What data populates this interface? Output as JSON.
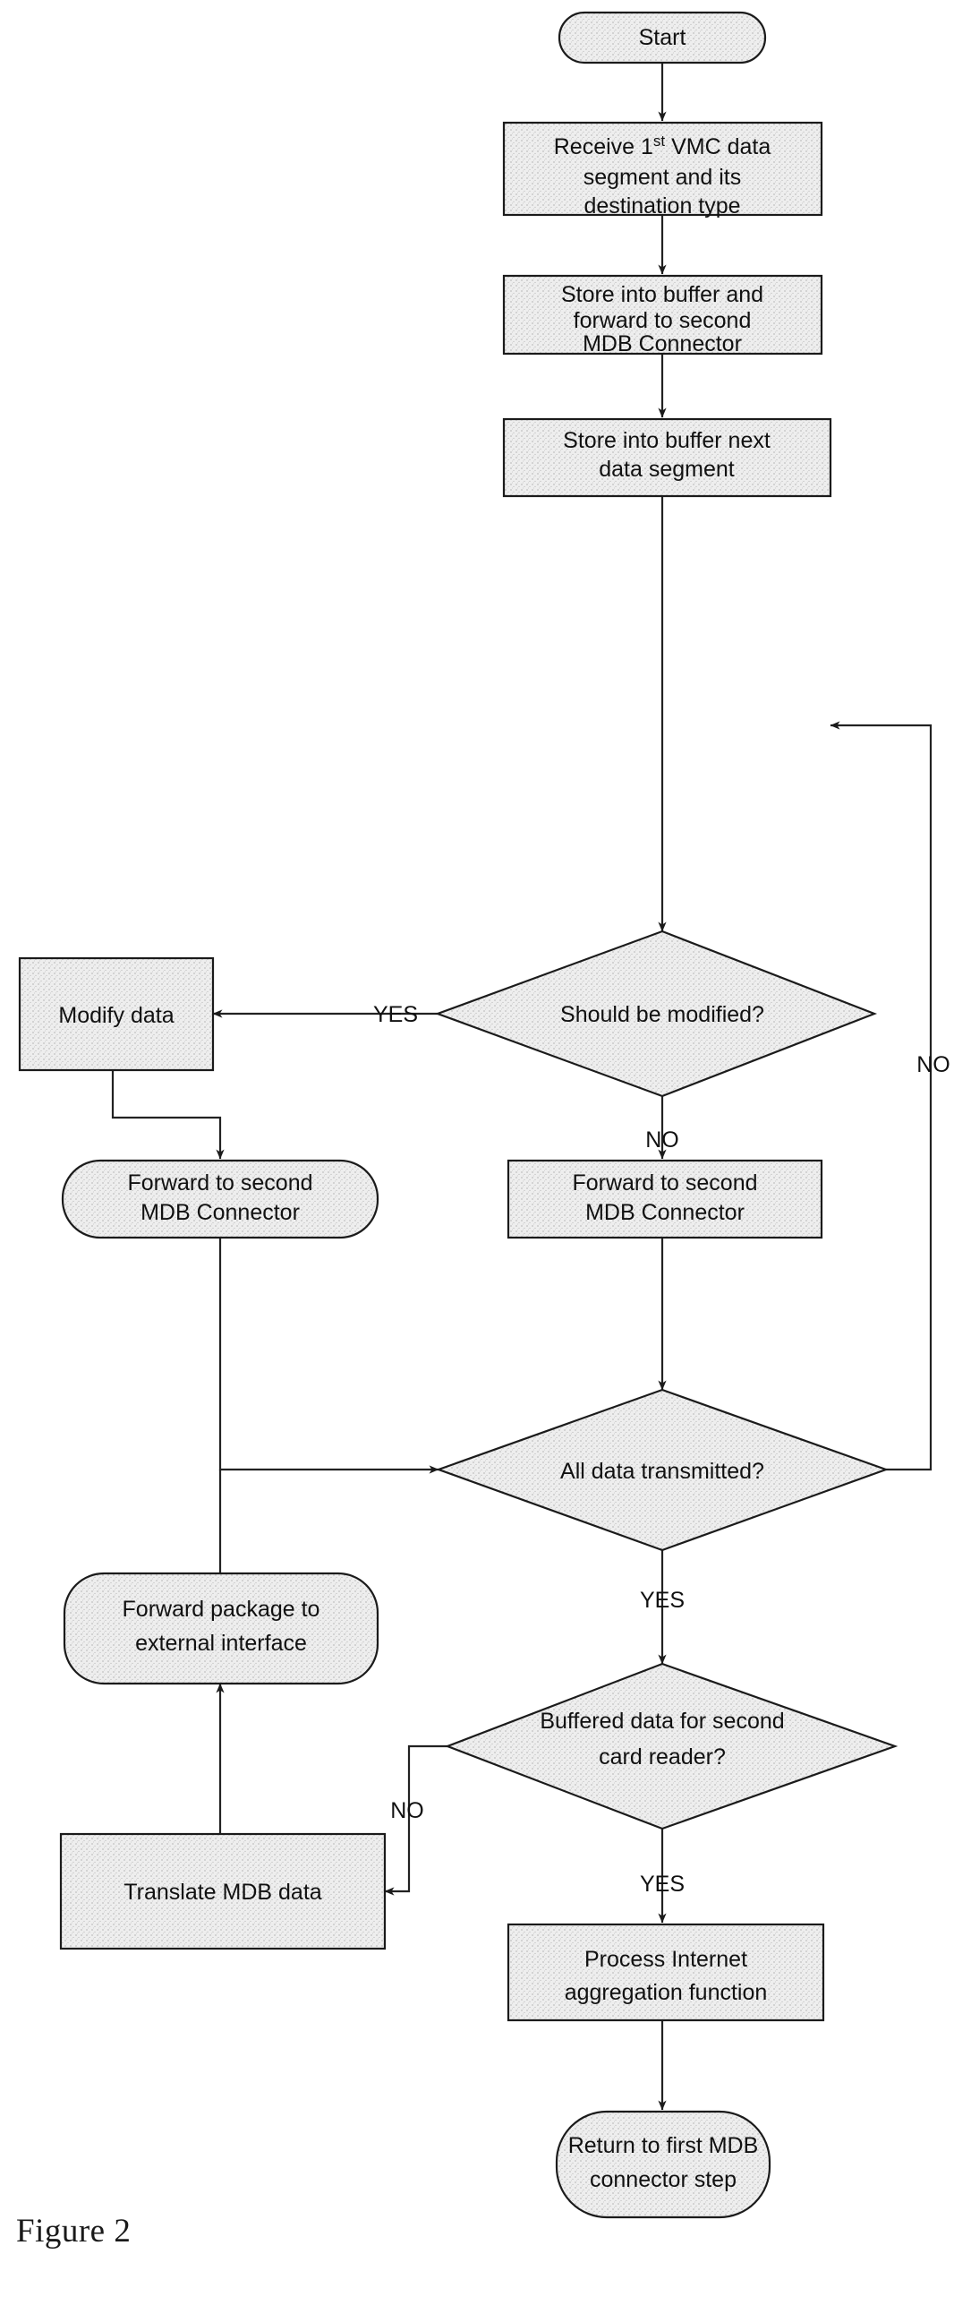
{
  "figure": {
    "caption": "Figure 2"
  },
  "style": {
    "fill": "#e9e9e9",
    "stroke": "#1b1b1b",
    "text": "#111111",
    "background": "#ffffff"
  },
  "nodes": [
    {
      "id": "start",
      "shape": "stadium",
      "lines": [
        "Start"
      ]
    },
    {
      "id": "receive",
      "shape": "rect",
      "lines": [
        "Receive 1st VMC data",
        "segment and its",
        "destination type"
      ],
      "superscript": "st"
    },
    {
      "id": "store-fwd",
      "shape": "rect",
      "lines": [
        "Store into buffer and",
        "forward to second",
        "MDB Connector"
      ]
    },
    {
      "id": "store-next",
      "shape": "rect",
      "lines": [
        "Store into buffer next",
        "data segment"
      ]
    },
    {
      "id": "should-mod",
      "shape": "diamond",
      "lines": [
        "Should be modified?"
      ]
    },
    {
      "id": "modify",
      "shape": "rect",
      "lines": [
        "Modify data"
      ]
    },
    {
      "id": "fwd-left",
      "shape": "roundrect",
      "lines": [
        "Forward to second",
        "MDB Connector"
      ]
    },
    {
      "id": "fwd-main",
      "shape": "rect",
      "lines": [
        "Forward to second",
        "MDB Connector"
      ]
    },
    {
      "id": "all-trans",
      "shape": "diamond",
      "lines": [
        "All data transmitted?"
      ]
    },
    {
      "id": "fwd-pkg",
      "shape": "roundrect",
      "lines": [
        "Forward package to",
        "external interface"
      ]
    },
    {
      "id": "buffered",
      "shape": "diamond",
      "lines": [
        "Buffered data for second",
        "card reader?"
      ]
    },
    {
      "id": "translate",
      "shape": "rect",
      "lines": [
        "Translate MDB data"
      ]
    },
    {
      "id": "process",
      "shape": "rect",
      "lines": [
        "Process Internet",
        "aggregation function"
      ]
    },
    {
      "id": "return",
      "shape": "stadium",
      "lines": [
        "Return to first MDB",
        "connector step"
      ]
    }
  ],
  "edge_labels": {
    "should_mod_yes": "YES",
    "should_mod_no": "NO",
    "all_trans_no": "NO",
    "all_trans_yes": "YES",
    "buffered_no": "NO",
    "buffered_yes": "YES"
  },
  "text": {
    "start": "Start",
    "receive_l1_a": "Receive 1",
    "receive_l1_sup": "st",
    "receive_l1_b": " VMC data",
    "receive_l2": "segment and its",
    "receive_l3": "destination type",
    "store_fwd_l1": "Store into buffer and",
    "store_fwd_l2": "forward to second",
    "store_fwd_l3": "MDB Connector",
    "store_next_l1": "Store into buffer next",
    "store_next_l2": "data segment",
    "should_mod": "Should be modified?",
    "modify": "Modify data",
    "fwd_left_l1": "Forward to second",
    "fwd_left_l2": "MDB Connector",
    "fwd_main_l1": "Forward to second",
    "fwd_main_l2": "MDB Connector",
    "all_trans": "All data transmitted?",
    "fwd_pkg_l1": "Forward package to",
    "fwd_pkg_l2": "external interface",
    "buffered_l1": "Buffered data for second",
    "buffered_l2": "card reader?",
    "translate": "Translate MDB data",
    "process_l1": "Process Internet",
    "process_l2": "aggregation function",
    "return_l1": "Return to first MDB",
    "return_l2": "connector step",
    "yes_1": "YES",
    "no_1": "NO",
    "no_2": "NO",
    "yes_2": "YES",
    "no_3": "NO",
    "yes_3": "YES",
    "caption": "Figure 2"
  }
}
